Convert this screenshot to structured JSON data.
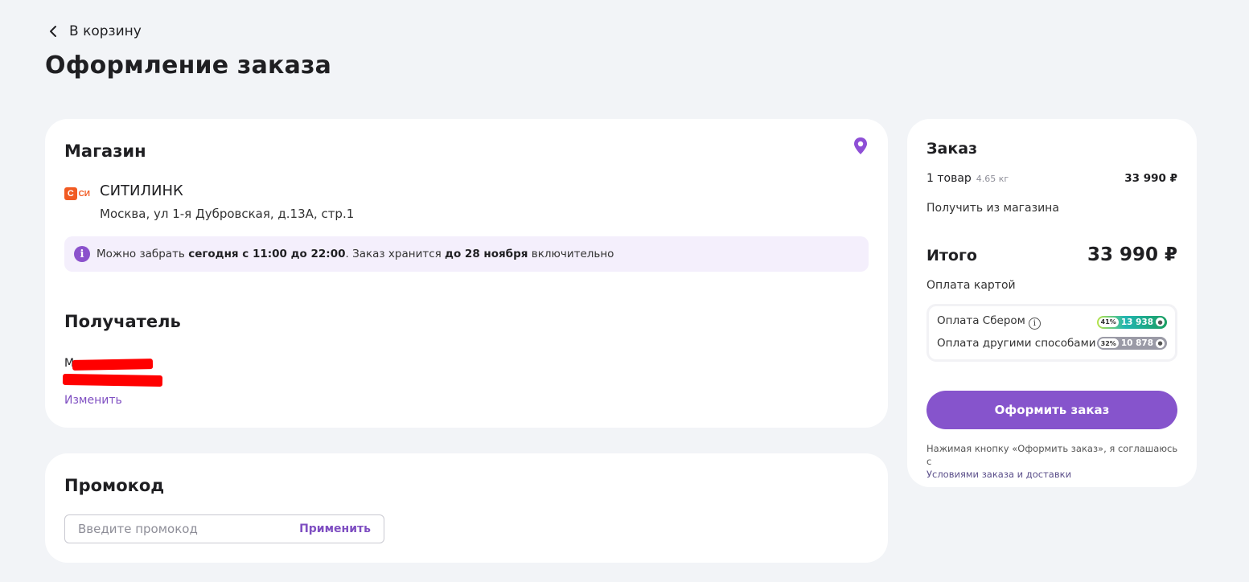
{
  "header": {
    "back_label": "В корзину",
    "page_title": "Оформление заказа"
  },
  "store_section": {
    "title": "Магазин",
    "store_name": "СИТИЛИНК",
    "store_logo_text": "СИ",
    "address": "Москва, ул 1-я Дубровская, д.13А, стр.1",
    "pickup_info": {
      "prefix": "Можно забрать ",
      "time": "сегодня с 11:00 до 22:00",
      "middle": ". Заказ хранится ",
      "deadline": "до 28 ноября",
      "suffix": " включительно"
    }
  },
  "recipient_section": {
    "title": "Получатель",
    "name_visible_start": "М",
    "change_label": "Изменить"
  },
  "promo_section": {
    "title": "Промокод",
    "placeholder": "Введите промокод",
    "value": "",
    "apply_label": "Применить"
  },
  "order_summary": {
    "title": "Заказ",
    "items_label": "1 товар",
    "weight": "4.65 кг",
    "items_price": "33 990 ₽",
    "delivery_method": "Получить из магазина",
    "total_label": "Итого",
    "total_value": "33 990 ₽",
    "payment_method": "Оплата картой",
    "payment_options": [
      {
        "label": "Оплата Сбером",
        "percent": "41%",
        "bonus": "13 938",
        "has_info": true
      },
      {
        "label": "Оплата другими способами",
        "percent": "32%",
        "bonus": "10 878",
        "has_info": false
      }
    ],
    "checkout_label": "Оформить заказ",
    "terms_text": "Нажимая кнопку «Оформить заказ», я соглашаюсь с",
    "terms_link": "Условиями заказа и доставки"
  },
  "colors": {
    "accent": "#8654cc",
    "page_bg": "#f2f4f7",
    "banner_bg": "#f4effc",
    "store_brand": "#f15a22",
    "redaction": "#ff0000"
  },
  "icons": [
    "chevron-left-icon",
    "location-pin-icon",
    "info-icon",
    "coin-icon"
  ]
}
